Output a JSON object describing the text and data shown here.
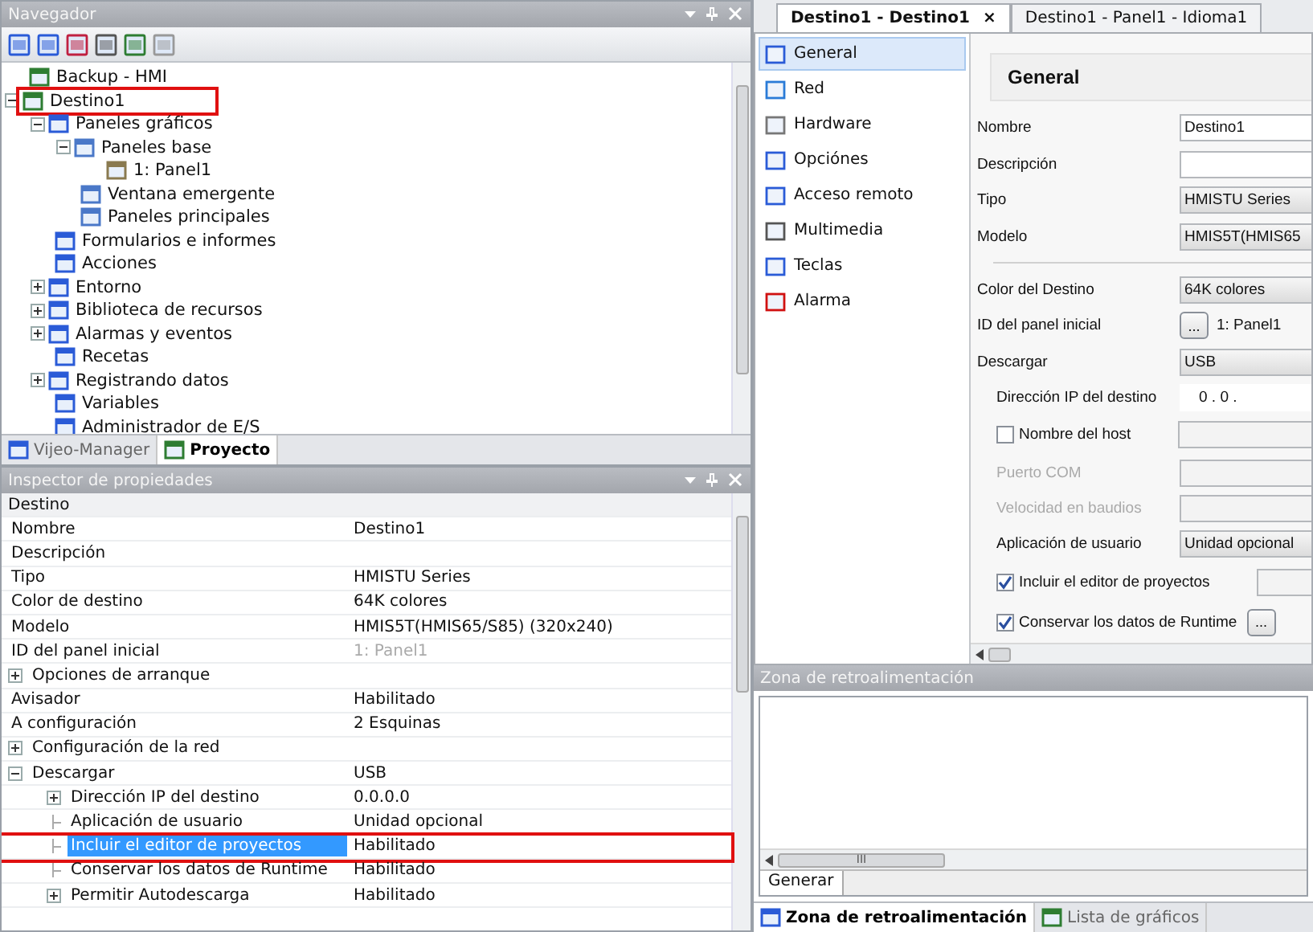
{
  "navigator": {
    "title": "Navegador",
    "tree": [
      {
        "label": "Backup - HMI",
        "highlighted": false
      },
      {
        "label": "Destino1",
        "expanded": true,
        "highlighted": true,
        "children": [
          {
            "label": "Paneles gráficos",
            "expanded": true,
            "highlighted": false,
            "children": [
              {
                "label": "Paneles base",
                "expanded": true,
                "highlighted": false,
                "children": [
                  {
                    "label": "1: Panel1",
                    "highlighted": false
                  }
                ]
              },
              {
                "label": "Ventana emergente",
                "highlighted": false
              },
              {
                "label": "Paneles principales",
                "highlighted": false
              }
            ]
          },
          {
            "label": "Formularios e informes",
            "highlighted": false
          },
          {
            "label": "Acciones",
            "highlighted": false
          },
          {
            "label": "Entorno",
            "expanded": false,
            "highlighted": false
          },
          {
            "label": "Biblioteca de recursos",
            "expanded": false,
            "highlighted": false
          },
          {
            "label": "Alarmas y eventos",
            "expanded": false,
            "highlighted": false
          },
          {
            "label": "Recetas",
            "highlighted": false
          },
          {
            "label": "Registrando datos",
            "expanded": false,
            "highlighted": false
          },
          {
            "label": "Variables",
            "highlighted": false
          },
          {
            "label": "Administrador de E/S",
            "highlighted": false
          }
        ]
      }
    ],
    "tabs": [
      {
        "label": "Vijeo-Manager",
        "selected": false
      },
      {
        "label": "Proyecto",
        "selected": true
      }
    ]
  },
  "inspector": {
    "title": "Inspector de propiedades",
    "category": "Destino",
    "rows": [
      {
        "name": "Nombre",
        "value": "Destino1",
        "selected": false,
        "highlighted": false,
        "disabled": false
      },
      {
        "name": "Descripción",
        "selected": false,
        "highlighted": false
      },
      {
        "name": "Tipo",
        "value": "HMISTU Series",
        "selected": false,
        "highlighted": false,
        "disabled": false
      },
      {
        "name": "Color de destino",
        "value": "64K colores",
        "selected": false,
        "highlighted": false,
        "disabled": false
      },
      {
        "name": "Modelo",
        "value": "HMIS5T(HMIS65/S85) (320x240)",
        "selected": false,
        "highlighted": false,
        "disabled": false
      },
      {
        "name": "ID del panel inicial",
        "value": "1: Panel1",
        "selected": false,
        "highlighted": false,
        "disabled": true
      },
      {
        "name": "Opciones  de arranque",
        "expanded": false,
        "selected": false,
        "highlighted": false
      },
      {
        "name": "Avisador",
        "value": "Habilitado",
        "selected": false,
        "highlighted": false,
        "disabled": false
      },
      {
        "name": "A configuración",
        "value": "2 Esquinas",
        "selected": false,
        "highlighted": false,
        "disabled": false
      },
      {
        "name": "Configuración de la red",
        "expanded": false,
        "selected": false,
        "highlighted": false
      },
      {
        "name": "Descargar",
        "value": "USB",
        "expanded": true,
        "selected": false,
        "highlighted": false,
        "disabled": false,
        "children": [
          {
            "name": "Dirección IP del destino",
            "value": "0.0.0.0",
            "expanded": false,
            "selected": false,
            "highlighted": false,
            "disabled": false
          },
          {
            "name": "Aplicación de usuario",
            "value": "Unidad opcional",
            "selected": false,
            "highlighted": false,
            "disabled": false
          },
          {
            "name": "Incluir el editor de proyectos",
            "value": "Habilitado",
            "selected": true,
            "highlighted": true,
            "disabled": false
          },
          {
            "name": "Conservar los datos de Runtime",
            "value": "Habilitado",
            "selected": false,
            "highlighted": false,
            "disabled": false
          },
          {
            "name": "Permitir Autodescarga",
            "value": "Habilitado",
            "expanded": false,
            "selected": false,
            "highlighted": false,
            "disabled": false
          }
        ]
      }
    ]
  },
  "editor": {
    "tabs": [
      {
        "label": "Destino1 - Destino1",
        "close": "×",
        "selected": true
      },
      {
        "label": "Destino1 - Panel1 - Idioma1",
        "selected": false
      }
    ],
    "sections": [
      {
        "label": "General",
        "selected": true
      },
      {
        "label": "Red",
        "selected": false
      },
      {
        "label": "Hardware",
        "selected": false
      },
      {
        "label": "Opciónes",
        "selected": false
      },
      {
        "label": "Acceso remoto",
        "selected": false
      },
      {
        "label": "Multimedia",
        "selected": false
      },
      {
        "label": "Teclas",
        "selected": false
      },
      {
        "label": "Alarma",
        "selected": false
      }
    ],
    "heading": "General",
    "fields": [
      {
        "kind": "text",
        "label": "Nombre",
        "value": "Destino1",
        "disabled": false
      },
      {
        "kind": "text",
        "label": "Descripción",
        "disabled": false
      },
      {
        "kind": "select",
        "label": "Tipo",
        "value": "HMISTU Series"
      },
      {
        "kind": "select",
        "label": "Modelo",
        "value": "HMIS5T(HMIS65"
      },
      {
        "kind": "divider"
      },
      {
        "kind": "select",
        "label": "Color del Destino",
        "value": "64K colores"
      },
      {
        "kind": "browse",
        "label": "ID del panel inicial",
        "button": "...",
        "value": "1: Panel1"
      },
      {
        "kind": "select",
        "label": "Descargar",
        "value": "USB",
        "children": [
          {
            "kind": "ip",
            "label": "Dirección IP del destino",
            "value": "0  .  0  ."
          },
          {
            "kind": "check",
            "label": "Nombre del host",
            "checked": false
          },
          {
            "kind": "text",
            "label": "Puerto COM",
            "disabled": true
          },
          {
            "kind": "text",
            "label": "Velocidad en baudios",
            "disabled": true
          },
          {
            "kind": "select",
            "label": "Aplicación de usuario",
            "value": "Unidad opcional"
          },
          {
            "kind": "check",
            "label": "Incluir el editor de proyectos",
            "checked": true
          },
          {
            "kind": "check",
            "label": "Conservar los datos de Runtime",
            "checked": true,
            "button": "..."
          }
        ]
      }
    ]
  },
  "feedback": {
    "title": "Zona de retroalimentación",
    "inner_tab": "Generar",
    "scroll_grip": "III",
    "tabs": [
      {
        "label": "Zona de retroalimentación",
        "selected": true
      },
      {
        "label": "Lista de gráficos",
        "selected": false
      }
    ]
  }
}
